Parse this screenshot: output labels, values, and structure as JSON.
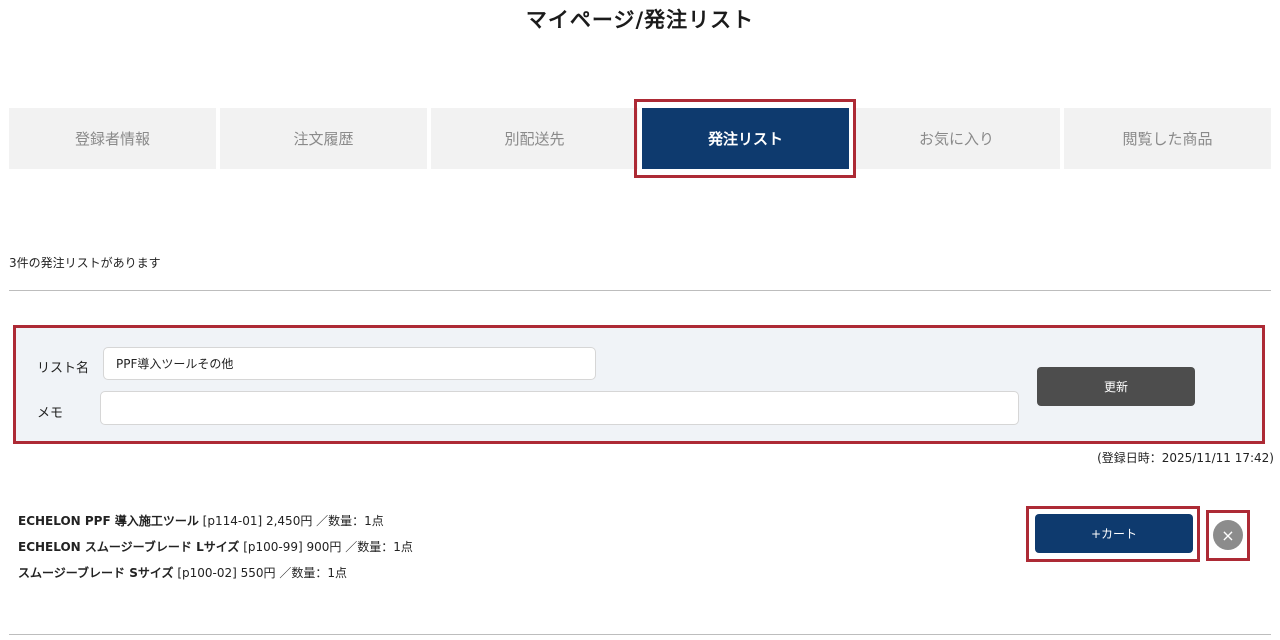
{
  "page_title": "マイページ/発注リスト",
  "tabs": [
    {
      "label": "登録者情報",
      "active": false
    },
    {
      "label": "注文履歴",
      "active": false
    },
    {
      "label": "別配送先",
      "active": false
    },
    {
      "label": "発注リスト",
      "active": true
    },
    {
      "label": "お気に入り",
      "active": false
    },
    {
      "label": "閲覧した商品",
      "active": false
    }
  ],
  "list_count_text": "3件の発注リストがあります",
  "list_form": {
    "name_label": "リスト名",
    "name_value": "PPF導入ツールその他",
    "memo_label": "メモ",
    "memo_value": "",
    "update_label": "更新"
  },
  "registered_text": "(登録日時：2025/11/11 17:42)",
  "items": [
    {
      "name": "ECHELON PPF 導入施工ツール",
      "detail": " [p114-01] 2,450円 ／数量：1点"
    },
    {
      "name": "ECHELON スムージーブレード Lサイズ",
      "detail": " [p100-99] 900円 ／数量：1点"
    },
    {
      "name": "スムージーブレード Sサイズ",
      "detail": " [p100-02] 550円 ／数量：1点"
    }
  ],
  "add_to_cart_label": "+カート",
  "delete_icon": "×",
  "colors": {
    "accent": "#0e3a6e",
    "highlight": "#ad2a35",
    "tab_bg": "#f2f2f2",
    "form_bg": "#f0f3f7"
  }
}
